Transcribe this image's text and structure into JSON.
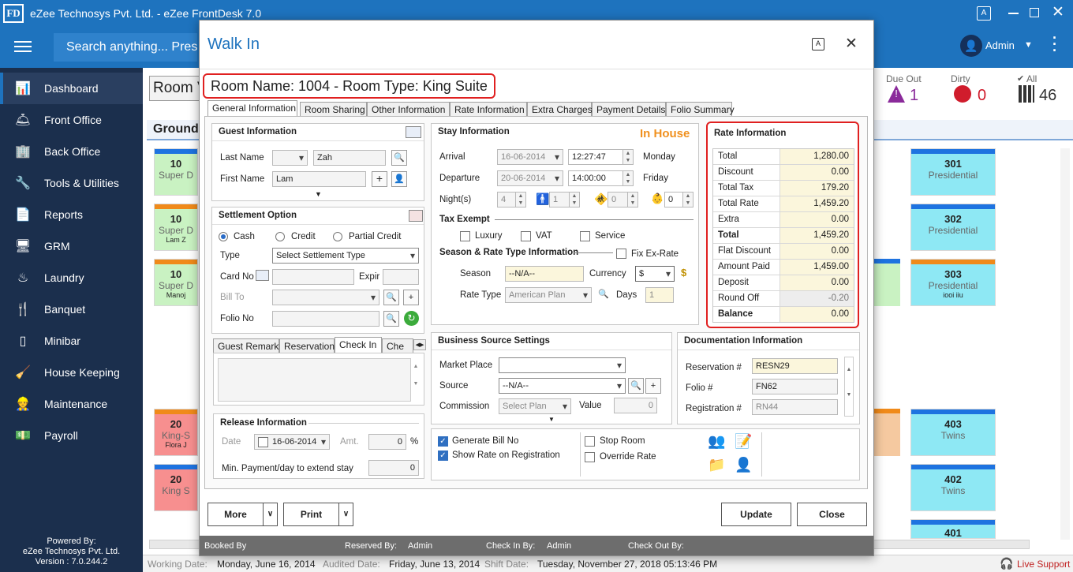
{
  "app": {
    "logo": "FD",
    "title": "eZee Technosys Pvt. Ltd. - eZee FrontDesk 7.0"
  },
  "toolbar": {
    "search_placeholder": "Search anything... Press",
    "user": "Admin"
  },
  "sidebar": {
    "items": [
      {
        "label": "Dashboard",
        "icon": "chart-icon"
      },
      {
        "label": "Front Office",
        "icon": "desk-icon"
      },
      {
        "label": "Back Office",
        "icon": "building-icon"
      },
      {
        "label": "Tools & Utilities",
        "icon": "tools-icon"
      },
      {
        "label": "Reports",
        "icon": "report-icon"
      },
      {
        "label": "GRM",
        "icon": "grm-icon"
      },
      {
        "label": "Laundry",
        "icon": "iron-icon"
      },
      {
        "label": "Banquet",
        "icon": "banquet-icon"
      },
      {
        "label": "Minibar",
        "icon": "minibar-icon"
      },
      {
        "label": "House Keeping",
        "icon": "housekeeping-icon"
      },
      {
        "label": "Maintenance",
        "icon": "maintenance-icon"
      },
      {
        "label": "Payroll",
        "icon": "payroll-icon"
      }
    ],
    "footer": {
      "line1": "Powered By:",
      "line2": "eZee Technosys Pvt. Ltd.",
      "line3": "Version : 7.0.244.2"
    }
  },
  "main": {
    "room_view_label": "Room V",
    "floor_label": "Ground",
    "stats": {
      "due_out_label": "Due Out",
      "due_out_value": "1",
      "dirty_label": "Dirty",
      "dirty_value": "0",
      "all_label": "All",
      "all_value": "46"
    },
    "rooms_left": [
      {
        "num": "10",
        "type": "Super D",
        "guest": ""
      },
      {
        "num": "10",
        "type": "Super D",
        "guest": "Lam Z"
      },
      {
        "num": "10",
        "type": "Super D",
        "guest": "Manoj"
      },
      {
        "num": "20",
        "type": "King-S",
        "guest": "Flora J"
      },
      {
        "num": "20",
        "type": "King S",
        "guest": ""
      }
    ],
    "rooms_right": [
      {
        "num": "301",
        "type": "Presidential",
        "guest": ""
      },
      {
        "num": "302",
        "type": "Presidential",
        "guest": ""
      },
      {
        "num": "303",
        "type": "Presidential",
        "guest": "iooi iiu"
      },
      {
        "num": "403",
        "type": "Twins",
        "guest": ""
      },
      {
        "num": "402",
        "type": "Twins",
        "guest": ""
      },
      {
        "num": "401",
        "type": "",
        "guest": ""
      }
    ]
  },
  "status_bar": {
    "working_date_label": "Working Date:",
    "working_date": "Monday, June 16, 2014",
    "audited_date_label": "Audited Date:",
    "audited_date": "Friday, June 13, 2014",
    "shift_date_label": "Shift Date:",
    "shift_date": "Tuesday, November 27, 2018 05:13:46 PM",
    "live_support": "Live Support"
  },
  "dialog": {
    "title": "Walk In",
    "room_heading": "Room Name: 1004 - Room Type: King Suite",
    "tabs": [
      "General Information",
      "Room Sharing",
      "Other Information",
      "Rate Information",
      "Extra Charges",
      "Payment Details",
      "Folio Summary"
    ],
    "guest": {
      "header": "Guest Information",
      "last_name_label": "Last Name",
      "last_name": "Zah",
      "first_name_label": "First Name",
      "first_name": "Lam"
    },
    "settlement": {
      "header": "Settlement Option",
      "options": [
        "Cash",
        "Credit",
        "Partial Credit"
      ],
      "type_label": "Type",
      "type_value": "Select Settlement Type",
      "card_no_label": "Card No",
      "expiry_label": "Expir",
      "bill_to_label": "Bill To",
      "folio_no_label": "Folio No"
    },
    "remark_tabs": [
      "Guest Remark",
      "Reservation",
      "Check In",
      "Che"
    ],
    "release": {
      "header": "Release Information",
      "date_label": "Date",
      "date_value": "16-06-2014",
      "amt_label": "Amt.",
      "amt_value": "0",
      "pct": "%",
      "min_payment_label": "Min. Payment/day to extend stay",
      "min_payment_value": "0"
    },
    "stay": {
      "header": "Stay Information",
      "status": "In House",
      "arrival_label": "Arrival",
      "arrival_date": "16-06-2014",
      "arrival_time": "12:27:47",
      "arrival_day": "Monday",
      "departure_label": "Departure",
      "departure_date": "20-06-2014",
      "departure_time": "14:00:00",
      "departure_day": "Friday",
      "nights_label": "Night(s)",
      "nights": "4",
      "adults": "1",
      "children": "0",
      "infants": "0",
      "tax_exempt_label": "Tax Exempt",
      "tax_options": [
        "Luxury",
        "VAT",
        "Service"
      ],
      "season_rate_label": "Season & Rate Type Information",
      "fix_ex_rate_label": "Fix Ex-Rate",
      "season_label": "Season",
      "season_value": "--N/A--",
      "currency_label": "Currency",
      "currency_value": "$",
      "rate_type_label": "Rate Type",
      "rate_type_value": "American Plan",
      "days_label": "Days",
      "days_value": "1"
    },
    "rate": {
      "header": "Rate Information",
      "rows": [
        {
          "label": "Total",
          "value": "1,280.00",
          "bold": false
        },
        {
          "label": "Discount",
          "value": "0.00",
          "bold": false
        },
        {
          "label": "Total Tax",
          "value": "179.20",
          "bold": false
        },
        {
          "label": "Total Rate",
          "value": "1,459.20",
          "bold": false
        },
        {
          "label": "Extra",
          "value": "0.00",
          "bold": false
        },
        {
          "label": "Total",
          "value": "1,459.20",
          "bold": true
        },
        {
          "label": "Flat Discount",
          "value": "0.00",
          "bold": false
        },
        {
          "label": "Amount Paid",
          "value": "1,459.00",
          "bold": false
        },
        {
          "label": "Deposit",
          "value": "0.00",
          "bold": false
        },
        {
          "label": "Round Off",
          "value": "-0.20",
          "bold": false
        },
        {
          "label": "Balance",
          "value": "0.00",
          "bold": true
        }
      ]
    },
    "business": {
      "header": "Business Source Settings",
      "market_place_label": "Market Place",
      "source_label": "Source",
      "source_value": "--N/A--",
      "commission_label": "Commission",
      "commission_value": "Select Plan",
      "value_label": "Value",
      "value_value": "0"
    },
    "documentation": {
      "header": "Documentation Information",
      "reservation_label": "Reservation #",
      "reservation_value": "RESN29",
      "folio_label": "Folio #",
      "folio_value": "FN62",
      "registration_label": "Registration #",
      "registration_value": "RN44"
    },
    "options": {
      "generate_bill": "Generate Bill No",
      "show_rate": "Show Rate on Registration",
      "stop_room": "Stop Room",
      "override_rate": "Override Rate"
    },
    "buttons": {
      "more": "More",
      "print": "Print",
      "update": "Update",
      "close": "Close"
    },
    "footer": {
      "booked_by_label": "Booked By",
      "reserved_by_label": "Reserved By:",
      "reserved_by": "Admin",
      "checkin_by_label": "Check In By:",
      "checkin_by": "Admin",
      "checkout_by_label": "Check Out By:"
    }
  },
  "colors": {
    "accent": "#1e73be",
    "sidebar": "#1b2f4d",
    "in_house": "#f0901e",
    "highlight": "#e02020"
  }
}
